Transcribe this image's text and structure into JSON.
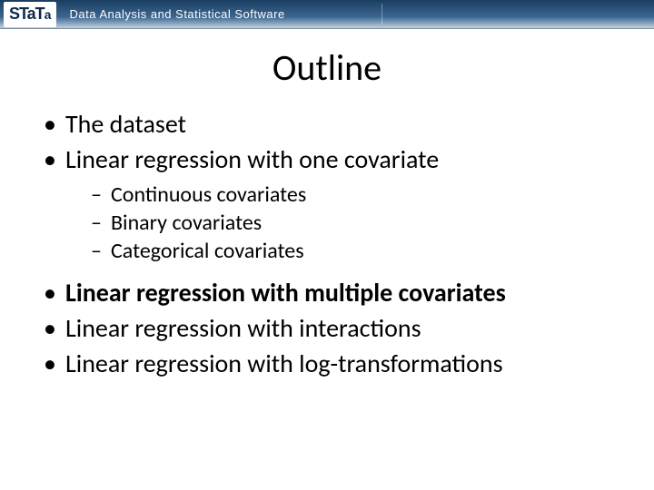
{
  "header": {
    "logo_main": "STaT",
    "logo_suffix": "a",
    "tagline": "Data Analysis and Statistical Software"
  },
  "title": "Outline",
  "bullets": {
    "b1": "The dataset",
    "b2": "Linear regression with one covariate",
    "b2_sub": {
      "s1": "Continuous covariates",
      "s2": "Binary covariates",
      "s3": "Categorical covariates"
    },
    "b3": "Linear regression with multiple covariates",
    "b4": "Linear regression with interactions",
    "b5": "Linear regression with log-transformations"
  }
}
